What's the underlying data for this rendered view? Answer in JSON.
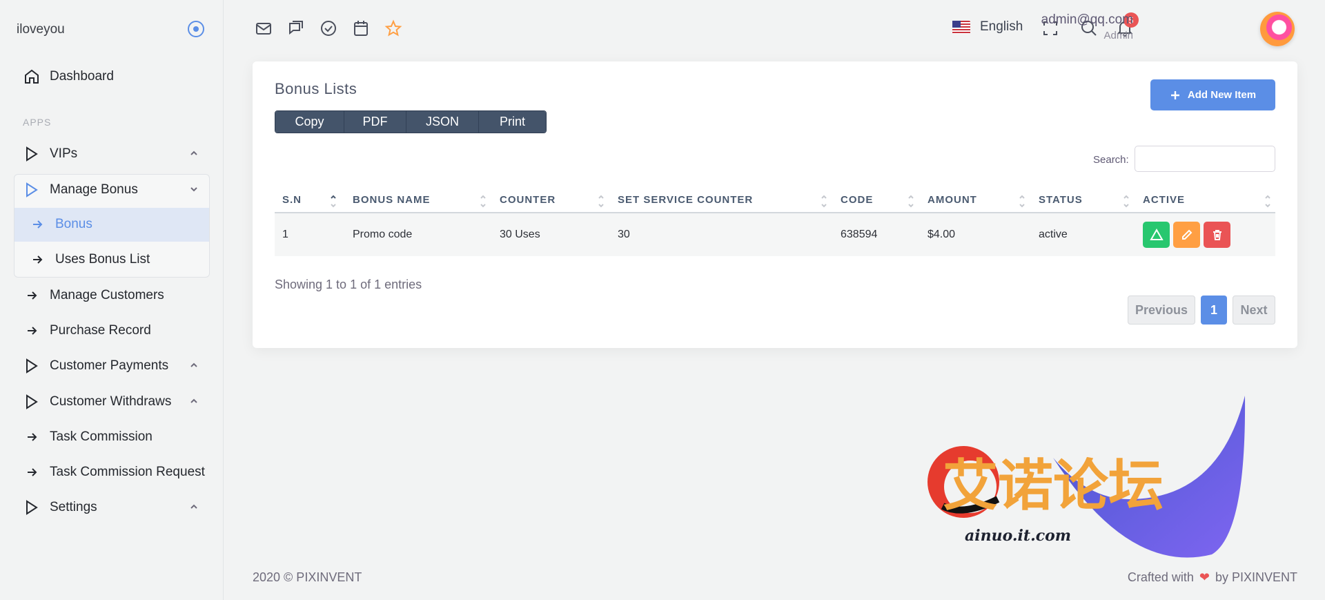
{
  "sidebar": {
    "brand": "iloveyou",
    "section_apps": "APPS",
    "items": [
      {
        "label": "Dashboard"
      },
      {
        "label": "VIPs"
      },
      {
        "label": "Manage Bonus"
      },
      {
        "label": "Bonus"
      },
      {
        "label": "Uses Bonus List"
      },
      {
        "label": "Manage Customers"
      },
      {
        "label": "Purchase Record"
      },
      {
        "label": "Customer Payments"
      },
      {
        "label": "Customer Withdraws"
      },
      {
        "label": "Task Commission"
      },
      {
        "label": "Task Commission Request"
      },
      {
        "label": "Settings"
      }
    ]
  },
  "topbar": {
    "language": "English",
    "notification_count": "5",
    "user_email": "admin@qq.com",
    "user_role": "Admin",
    "icons": [
      "mail-icon",
      "chat-icon",
      "check-circle-icon",
      "calendar-icon",
      "star-icon",
      "flag-us-icon",
      "fullscreen-icon",
      "search-icon",
      "bell-icon"
    ]
  },
  "card": {
    "title": "Bonus Lists",
    "add_button": "Add New Item",
    "export_buttons": [
      "Copy",
      "PDF",
      "JSON",
      "Print"
    ],
    "search_label": "Search:",
    "search_value": "",
    "columns": [
      "S.N",
      "BONUS NAME",
      "COUNTER",
      "SET SERVICE COUNTER",
      "CODE",
      "AMOUNT",
      "STATUS",
      "ACTIVE"
    ],
    "rows": [
      {
        "sn": "1",
        "bonus_name": "Promo code",
        "counter": "30 Uses",
        "set_service_counter": "30",
        "code": "638594",
        "amount": "$4.00",
        "status": "active"
      }
    ],
    "info": "Showing 1 to 1 of 1 entries",
    "pager": {
      "previous": "Previous",
      "page": "1",
      "next": "Next"
    }
  },
  "footer": {
    "left": "2020 © PIXINVENT",
    "crafted": "Crafted with",
    "by": "by PIXINVENT"
  },
  "watermark": {
    "title": "艾诺论坛",
    "url": "ainuo.it.com"
  },
  "colors": {
    "primary": "#5b8ee6",
    "success": "#28c76f",
    "warning": "#ff9f43",
    "danger": "#ea5455",
    "export": "#44546a"
  }
}
